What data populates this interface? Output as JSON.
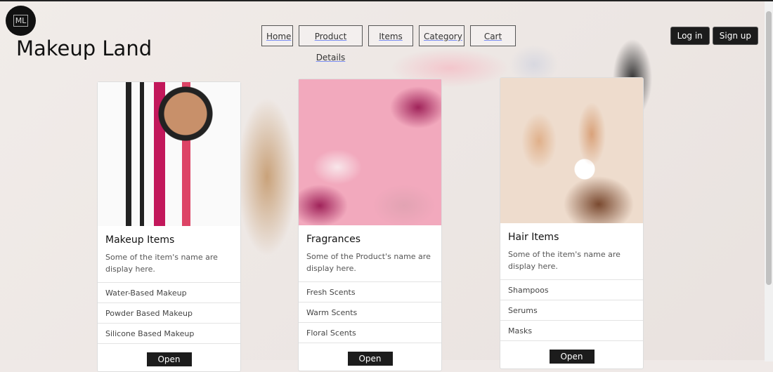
{
  "brand": {
    "logo_text": "ML",
    "title": "Makeup Land"
  },
  "nav": [
    "Home",
    "Product Details",
    "Items",
    "Category",
    "Cart"
  ],
  "auth": {
    "login": "Log in",
    "signup": "Sign up"
  },
  "cards": [
    {
      "title": "Makeup Items",
      "desc": "Some of the item's name are display here.",
      "items": [
        "Water-Based Makeup",
        "Powder Based Makeup",
        "Silicone Based Makeup"
      ],
      "button": "Open"
    },
    {
      "title": "Fragrances",
      "desc": "Some of the Product's name are display here.",
      "items": [
        "Fresh Scents",
        "Warm Scents",
        "Floral Scents"
      ],
      "button": "Open"
    },
    {
      "title": "Hair Items",
      "desc": "Some of the item's name are display here.",
      "items": [
        "Shampoos",
        "Serums",
        "Masks"
      ],
      "button": "Open"
    }
  ]
}
